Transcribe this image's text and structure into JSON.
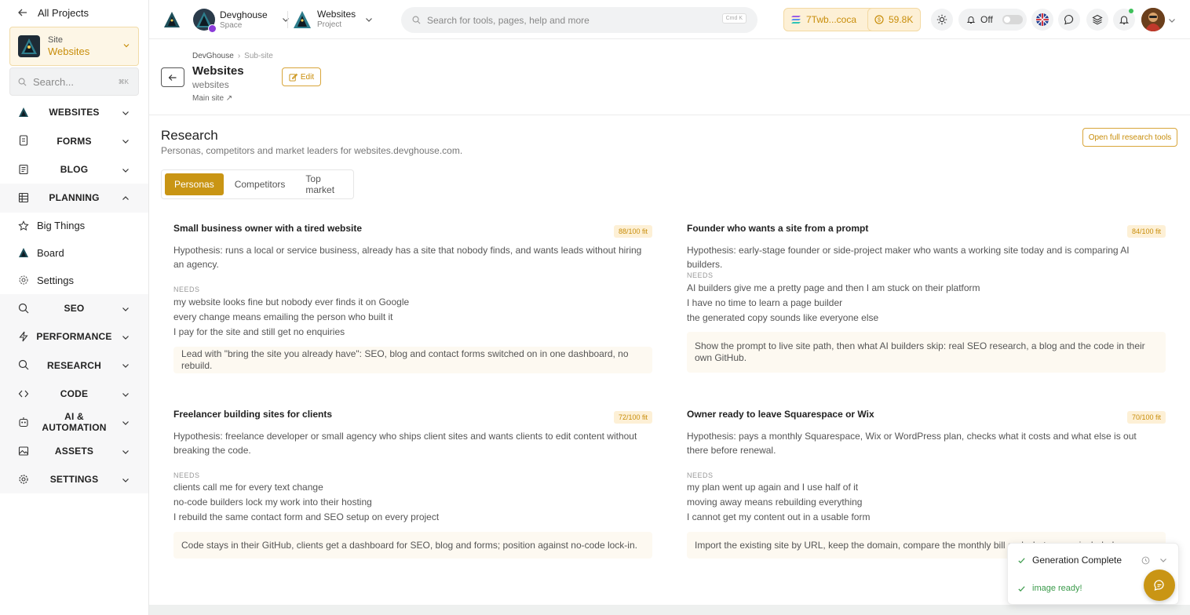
{
  "sidebar": {
    "all_projects": "All Projects",
    "site_card": {
      "label": "Site",
      "value": "Websites"
    },
    "search": {
      "placeholder": "Search...",
      "shortcut": "⌘K"
    },
    "nav": [
      {
        "label": "WEBSITES",
        "icon": "websites-logo-icon"
      },
      {
        "label": "FORMS",
        "icon": "form-icon"
      },
      {
        "label": "BLOG",
        "icon": "blog-icon"
      },
      {
        "label": "PLANNING",
        "icon": "grid-icon",
        "expanded": true,
        "children": [
          {
            "label": "Big Things",
            "icon": "star-icon"
          },
          {
            "label": "Board",
            "icon": "board-logo-icon"
          },
          {
            "label": "Settings",
            "icon": "gear-icon"
          }
        ]
      },
      {
        "label": "SEO",
        "icon": "search-icon"
      },
      {
        "label": "PERFORMANCE",
        "icon": "bolt-icon"
      },
      {
        "label": "RESEARCH",
        "icon": "search-icon"
      },
      {
        "label": "CODE",
        "icon": "code-icon"
      },
      {
        "label": "AI & AUTOMATION",
        "icon": "robot-icon"
      },
      {
        "label": "ASSETS",
        "icon": "image-icon"
      },
      {
        "label": "SETTINGS",
        "icon": "gear-icon"
      }
    ]
  },
  "topbar": {
    "workspace": {
      "title": "Devghouse",
      "subtitle": "Space"
    },
    "project": {
      "title": "Websites",
      "subtitle": "Project"
    },
    "search": {
      "placeholder": "Search for tools, pages, help and more",
      "shortcut": "Cmd K"
    },
    "wallet": "7Twb...coca",
    "coins": "59.8K",
    "notifications": "Off",
    "colors": {
      "accent": "#c99514",
      "accent_bg": "#fdf0d6",
      "success": "#3a9a4a"
    }
  },
  "page": {
    "breadcrumb": [
      "DevGhouse",
      "Sub-site"
    ],
    "title": "Websites",
    "subtitle": "websites",
    "link": "Main site ↗",
    "edit": "Edit"
  },
  "research": {
    "title": "Research",
    "description": "Personas, competitors and market leaders for websites.devghouse.com.",
    "open_full": "Open full research tools",
    "tabs": [
      "Personas",
      "Competitors",
      "Top market"
    ],
    "active_tab": "Personas",
    "needs_label": "NEEDS",
    "personas": [
      {
        "title": "Small business owner with a tired website",
        "fit": "88/100 fit",
        "hypothesis": "Hypothesis: runs a local or service business, already has a site that nobody finds, and wants leads without hiring an agency.",
        "needs": [
          "my website looks fine but nobody ever finds it on Google",
          "every change means emailing the person who built it",
          "I pay for the site and still get no enquiries"
        ],
        "pitch": "Lead with \"bring the site you already have\": SEO, blog and contact forms switched on in one dashboard, no rebuild."
      },
      {
        "title": "Founder who wants a site from a prompt",
        "fit": "84/100 fit",
        "hypothesis": "Hypothesis: early-stage founder or side-project maker who wants a working site today and is comparing AI builders.",
        "needs": [
          "AI builders give me a pretty page and then I am stuck on their platform",
          "I have no time to learn a page builder",
          "the generated copy sounds like everyone else"
        ],
        "pitch": "Show the prompt to live site path, then what AI builders skip: real SEO research, a blog and the code in their own GitHub."
      },
      {
        "title": "Freelancer building sites for clients",
        "fit": "72/100 fit",
        "hypothesis": "Hypothesis: freelance developer or small agency who ships client sites and wants clients to edit content without breaking the code.",
        "needs": [
          "clients call me for every text change",
          "no-code builders lock my work into their hosting",
          "I rebuild the same contact form and SEO setup on every project"
        ],
        "pitch": "Code stays in their GitHub, clients get a dashboard for SEO, blog and forms; position against no-code lock-in."
      },
      {
        "title": "Owner ready to leave Squarespace or Wix",
        "fit": "70/100 fit",
        "hypothesis": "Hypothesis: pays a monthly Squarespace, Wix or WordPress plan, checks what it costs and what else is out there before renewal.",
        "needs": [
          "my plan went up again and I use half of it",
          "moving away means rebuilding everything",
          "I cannot get my content out in a usable form"
        ],
        "pitch": "Import the existing site by URL, keep the domain, compare the monthly bill and what comes included."
      }
    ]
  },
  "toast": {
    "title": "Generation Complete",
    "message": "image ready!"
  }
}
